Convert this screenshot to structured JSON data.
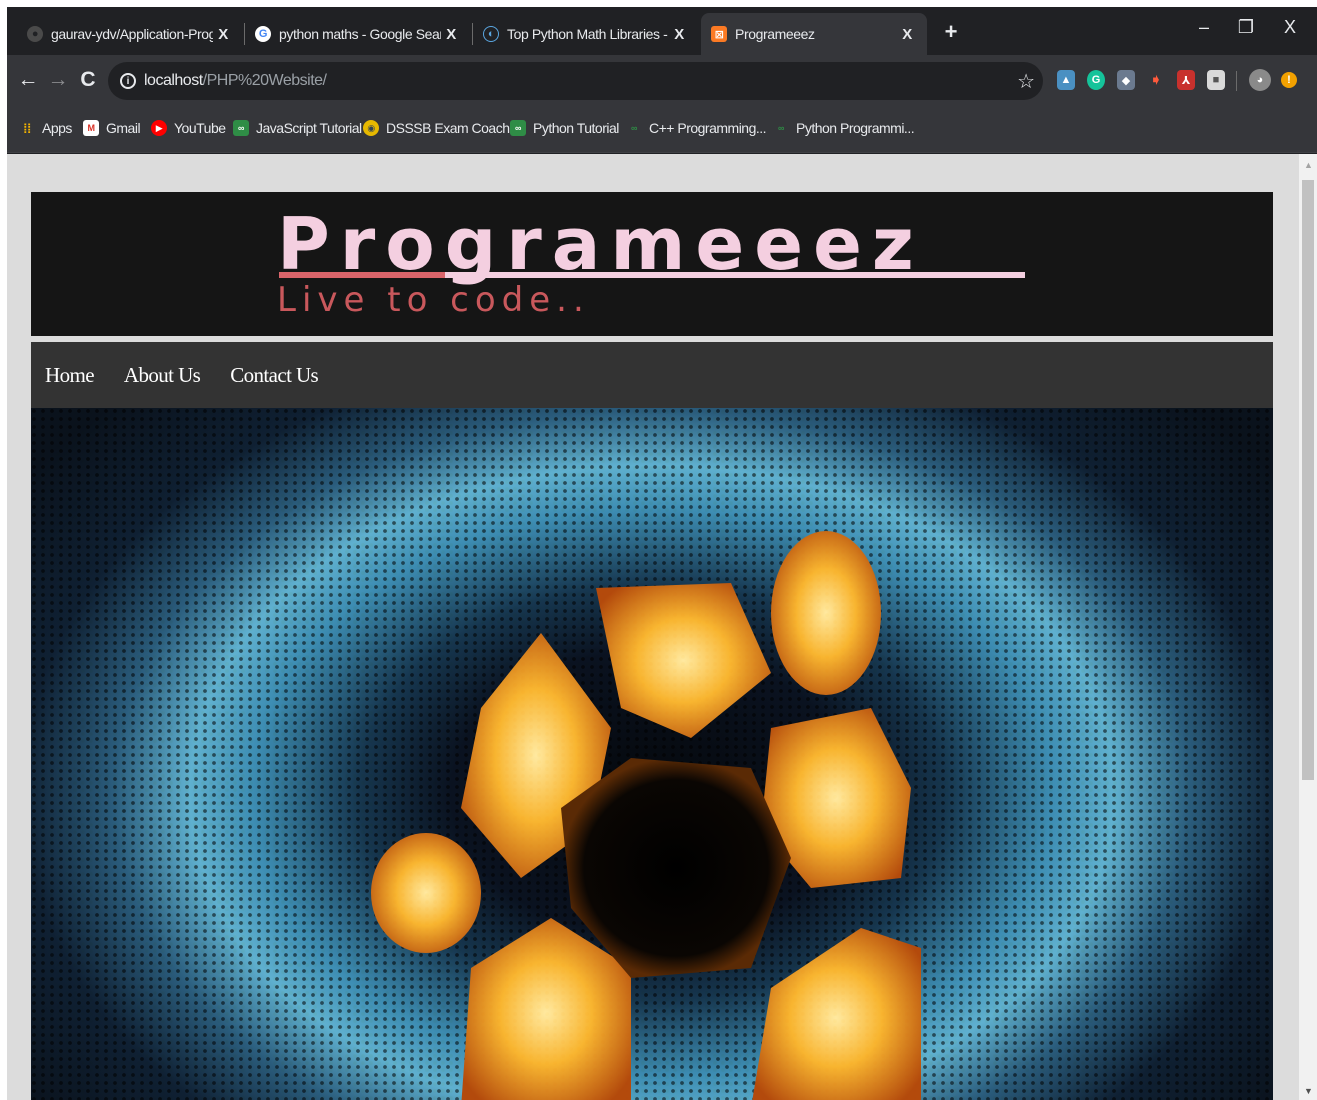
{
  "browser": {
    "tabs": [
      {
        "title": "gaurav-ydv/Application-Program",
        "favicon": "github-icon",
        "active": false
      },
      {
        "title": "python maths - Google Search",
        "favicon": "google-icon",
        "active": false
      },
      {
        "title": "Top Python Math Libraries - Solv",
        "favicon": "site-icon",
        "active": false
      },
      {
        "title": "Programeeez",
        "favicon": "xampp-icon",
        "active": true
      }
    ],
    "tab_close": "X",
    "new_tab": "+",
    "window_controls": {
      "minimize": "–",
      "restore": "❐",
      "close": "X"
    },
    "nav": {
      "back": "←",
      "forward": "→",
      "reload": "C"
    },
    "url": {
      "host": "localhost",
      "path": "/PHP%20Website/"
    },
    "bookmarks": [
      {
        "label": "Apps",
        "icon": "apps-icon",
        "color": "#f4b400"
      },
      {
        "label": "Gmail",
        "icon": "gmail-icon",
        "color": "#d93025"
      },
      {
        "label": "YouTube",
        "icon": "youtube-icon",
        "color": "#ff0000"
      },
      {
        "label": "JavaScript Tutorial",
        "icon": "gfg-icon",
        "color": "#2f8d46"
      },
      {
        "label": "DSSSB Exam Coachi...",
        "icon": "dsssb-icon",
        "color": "#e6b800"
      },
      {
        "label": "Python Tutorial",
        "icon": "gfg-icon",
        "color": "#2f8d46"
      },
      {
        "label": "C++ Programming...",
        "icon": "gfg-icon",
        "color": "#2f8d46"
      },
      {
        "label": "Python Programmi...",
        "icon": "gfg-icon",
        "color": "#2f8d46"
      }
    ]
  },
  "site": {
    "logo_title": "Programeeez",
    "tagline": "Live to code..",
    "nav": [
      "Home",
      "About Us",
      "Contact Us"
    ],
    "colors": {
      "logo_text": "#f4cfe0",
      "tagline": "#c9585c",
      "header_bg": "#151515",
      "nav_bg": "#333333"
    }
  }
}
